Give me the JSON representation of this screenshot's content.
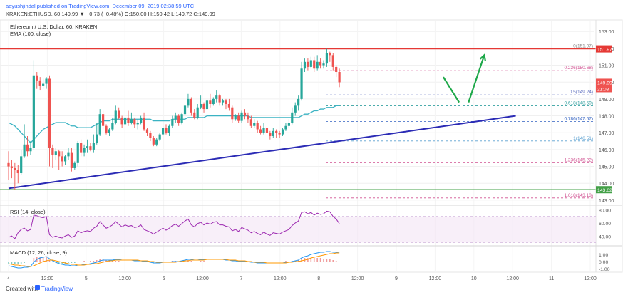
{
  "header": {
    "line1": "aayushjindal published on TradingView.com, December 09, 2019 02:38:59 UTC",
    "line2": "KRAKEN:ETHUSD, 60  149.99  ▼ −0.73 (−0.48%)  O:150.00  H:150.42  L:149.72  C:149.99"
  },
  "legend": {
    "title": "Ethereum / U.S. Dollar, 60, KRAKEN",
    "ema": "EMA (100, close)"
  },
  "footer": {
    "created_with": "Created with",
    "brand": "TradingView"
  },
  "colors": {
    "up": "#26a69a",
    "down": "#ef5350",
    "ema": "#3bb3c3",
    "trend": "#2b2bb5",
    "resistance": "#e53935",
    "support": "#43a047",
    "arrow": "#1ea84a",
    "rsi": "#9c27b0",
    "macd": "#2196f3",
    "signal": "#ff9800"
  },
  "chart_data": [
    {
      "type": "candlestick",
      "title": "Ethereum / U.S. Dollar, 60, KRAKEN",
      "ylim": [
        142.7,
        153.6
      ],
      "y_ticks": [
        "153.00",
        "152.00",
        "151.00",
        "150.00",
        "149.00",
        "148.00",
        "147.00",
        "146.00",
        "145.00",
        "144.00",
        "143.00"
      ],
      "x_ticks": [
        "4",
        "12:00",
        "5",
        "12:00",
        "6",
        "12:00",
        "7",
        "12:00",
        "8",
        "12:00",
        "9",
        "12:00",
        "10",
        "12:00",
        "11",
        "12:00"
      ],
      "price_labels": {
        "resistance": "151.97",
        "last": "149.99",
        "countdown": "21:08",
        "support": "143.62"
      },
      "horizontal_lines": {
        "resistance": 151.97,
        "support": 143.62
      },
      "fib_levels": [
        {
          "label": "0(151.97)",
          "value": 151.97
        },
        {
          "label": "0.236(150.68)",
          "value": 150.68
        },
        {
          "label": "0.5(149.24)",
          "value": 149.24
        },
        {
          "label": "0.618(148.59)",
          "value": 148.59
        },
        {
          "label": "0.786(147.67)",
          "value": 147.67
        },
        {
          "label": "1(146.51)",
          "value": 146.51
        },
        {
          "label": "1.236(145.22)",
          "value": 145.22
        },
        {
          "label": "1.618(143.13)",
          "value": 143.13
        }
      ],
      "candles": [
        [
          145.2,
          145.0,
          145.9,
          144.2
        ],
        [
          145.0,
          144.9,
          145.4,
          144.3
        ],
        [
          144.9,
          144.8,
          145.2,
          143.6
        ],
        [
          144.8,
          144.6,
          145.1,
          144.0
        ],
        [
          144.6,
          145.6,
          146.0,
          144.5
        ],
        [
          145.6,
          146.3,
          147.5,
          145.5
        ],
        [
          146.3,
          145.9,
          146.8,
          145.6
        ],
        [
          145.9,
          146.1,
          146.5,
          145.7
        ],
        [
          146.1,
          150.4,
          151.3,
          146.0
        ],
        [
          150.4,
          150.1,
          150.6,
          149.6
        ],
        [
          150.1,
          149.8,
          150.3,
          149.5
        ],
        [
          149.8,
          149.9,
          150.2,
          149.6
        ],
        [
          149.9,
          150.2,
          150.3,
          149.6
        ],
        [
          150.2,
          146.1,
          150.4,
          145.0
        ],
        [
          146.1,
          145.7,
          146.3,
          144.9
        ],
        [
          145.7,
          145.9,
          146.1,
          145.4
        ],
        [
          145.9,
          145.6,
          146.0,
          144.8
        ],
        [
          145.6,
          145.3,
          145.9,
          145.0
        ],
        [
          145.3,
          145.6,
          145.7,
          145.1
        ],
        [
          145.6,
          145.8,
          146.1,
          145.4
        ],
        [
          145.8,
          144.9,
          146.1,
          144.7
        ],
        [
          144.9,
          145.2,
          145.3,
          144.8
        ],
        [
          145.2,
          146.4,
          146.5,
          145.0
        ],
        [
          146.4,
          145.8,
          146.6,
          145.6
        ],
        [
          145.8,
          146.1,
          146.3,
          145.6
        ],
        [
          146.1,
          146.2,
          146.6,
          145.8
        ],
        [
          146.2,
          146.0,
          146.4,
          145.9
        ],
        [
          146.0,
          146.4,
          146.9,
          145.8
        ],
        [
          146.4,
          146.9,
          147.6,
          146.3
        ],
        [
          146.9,
          148.1,
          148.4,
          146.8
        ],
        [
          148.1,
          147.4,
          148.3,
          147.2
        ],
        [
          147.4,
          147.0,
          147.5,
          146.9
        ],
        [
          147.0,
          147.2,
          147.3,
          146.8
        ],
        [
          147.2,
          147.6,
          147.9,
          147.1
        ],
        [
          147.6,
          148.3,
          148.6,
          147.5
        ],
        [
          148.3,
          147.9,
          148.5,
          147.8
        ],
        [
          147.9,
          147.5,
          148.0,
          147.3
        ],
        [
          147.5,
          147.9,
          148.0,
          147.4
        ],
        [
          147.9,
          147.6,
          148.3,
          147.4
        ],
        [
          147.6,
          147.8,
          148.2,
          147.5
        ],
        [
          147.8,
          147.5,
          147.9,
          147.3
        ],
        [
          147.5,
          147.6,
          147.8,
          147.2
        ],
        [
          147.6,
          147.9,
          148.0,
          147.5
        ],
        [
          147.9,
          147.2,
          148.2,
          147.1
        ],
        [
          147.2,
          147.0,
          147.3,
          146.8
        ],
        [
          147.0,
          146.7,
          147.1,
          146.5
        ],
        [
          146.7,
          146.3,
          146.8,
          146.2
        ],
        [
          146.3,
          146.6,
          146.7,
          146.2
        ],
        [
          146.6,
          146.9,
          147.0,
          146.5
        ],
        [
          146.9,
          147.3,
          147.4,
          146.8
        ],
        [
          147.3,
          147.0,
          147.5,
          146.9
        ],
        [
          147.0,
          147.4,
          147.5,
          146.8
        ],
        [
          147.4,
          147.8,
          148.0,
          147.3
        ],
        [
          147.8,
          148.0,
          148.2,
          147.6
        ],
        [
          148.0,
          147.6,
          148.1,
          147.4
        ],
        [
          147.6,
          148.1,
          148.2,
          147.5
        ],
        [
          148.1,
          148.6,
          148.9,
          148.0
        ],
        [
          148.6,
          149.0,
          149.3,
          148.5
        ],
        [
          149.0,
          148.2,
          149.1,
          148.0
        ],
        [
          148.2,
          147.9,
          148.4,
          147.8
        ],
        [
          147.9,
          148.5,
          148.7,
          147.8
        ],
        [
          148.5,
          148.7,
          149.2,
          148.4
        ],
        [
          148.7,
          148.4,
          148.8,
          148.2
        ],
        [
          148.4,
          148.9,
          149.0,
          148.3
        ],
        [
          148.9,
          148.7,
          149.3,
          148.5
        ],
        [
          148.7,
          149.0,
          149.1,
          148.6
        ],
        [
          149.0,
          149.2,
          149.5,
          148.8
        ],
        [
          149.2,
          148.8,
          149.3,
          148.6
        ],
        [
          148.8,
          148.9,
          149.0,
          148.6
        ],
        [
          148.9,
          148.7,
          149.0,
          148.4
        ],
        [
          148.7,
          148.5,
          149.0,
          148.3
        ],
        [
          148.5,
          147.8,
          148.6,
          147.6
        ],
        [
          147.8,
          148.0,
          148.1,
          147.7
        ],
        [
          148.0,
          147.7,
          148.2,
          147.6
        ],
        [
          147.7,
          148.2,
          148.3,
          147.6
        ],
        [
          148.2,
          148.0,
          148.4,
          147.8
        ],
        [
          148.0,
          147.8,
          148.2,
          147.6
        ],
        [
          147.8,
          147.4,
          148.0,
          147.3
        ],
        [
          147.4,
          147.6,
          147.8,
          147.3
        ],
        [
          147.6,
          147.2,
          147.7,
          147.0
        ],
        [
          147.2,
          147.0,
          147.4,
          146.9
        ],
        [
          147.0,
          147.3,
          147.6,
          146.9
        ],
        [
          147.3,
          147.0,
          147.4,
          146.9
        ],
        [
          147.0,
          146.8,
          147.1,
          146.6
        ],
        [
          146.8,
          147.1,
          147.3,
          146.7
        ],
        [
          147.1,
          147.0,
          147.2,
          146.7
        ],
        [
          147.0,
          146.9,
          147.1,
          146.7
        ],
        [
          146.9,
          147.2,
          147.3,
          146.8
        ],
        [
          147.2,
          147.4,
          147.6,
          147.1
        ],
        [
          147.4,
          147.6,
          147.8,
          147.3
        ],
        [
          147.6,
          148.2,
          148.5,
          147.5
        ],
        [
          148.2,
          148.6,
          148.8,
          148.0
        ],
        [
          148.6,
          149.0,
          149.2,
          148.3
        ],
        [
          149.0,
          150.8,
          151.2,
          148.9
        ],
        [
          150.8,
          151.2,
          151.4,
          150.6
        ],
        [
          151.2,
          150.9,
          151.4,
          150.7
        ],
        [
          150.9,
          151.3,
          151.5,
          150.8
        ],
        [
          151.3,
          150.8,
          151.5,
          150.6
        ],
        [
          150.8,
          151.2,
          151.6,
          150.7
        ],
        [
          151.2,
          151.0,
          151.4,
          150.8
        ],
        [
          151.0,
          151.1,
          151.3,
          150.8
        ],
        [
          151.1,
          151.7,
          151.97,
          150.9
        ],
        [
          151.7,
          151.6,
          151.8,
          151.2
        ],
        [
          151.6,
          150.9,
          151.7,
          150.7
        ],
        [
          150.9,
          150.6,
          151.0,
          150.3
        ],
        [
          150.6,
          149.99,
          150.8,
          149.7
        ]
      ],
      "ema": [
        147.6,
        147.5,
        147.4,
        147.2,
        147.0,
        146.8,
        146.6,
        146.4,
        146.6,
        146.8,
        147.0,
        147.2,
        147.3,
        147.4,
        147.5,
        147.6,
        147.6,
        147.6,
        147.6,
        147.5,
        147.4,
        147.4,
        147.3,
        147.3,
        147.3,
        147.3,
        147.3,
        147.4,
        147.5,
        147.6,
        147.7,
        147.7,
        147.7,
        147.8,
        147.8,
        147.8,
        147.8,
        147.8,
        147.8,
        147.8,
        147.8,
        147.8,
        147.8,
        147.8,
        147.8,
        147.8,
        147.7,
        147.7,
        147.7,
        147.7,
        147.7,
        147.7,
        147.8,
        147.8,
        147.8,
        147.8,
        147.8,
        147.9,
        147.9,
        147.9,
        147.9,
        147.9,
        147.9,
        148.0,
        148.0,
        148.0,
        148.0,
        148.0,
        148.0,
        148.0,
        148.0,
        148.0,
        148.0,
        148.0,
        148.0,
        148.0,
        148.0,
        147.9,
        147.9,
        147.9,
        147.9,
        147.9,
        147.9,
        147.9,
        147.9,
        147.9,
        147.9,
        147.9,
        147.9,
        147.9,
        147.9,
        147.9,
        147.9,
        148.0,
        148.1,
        148.1,
        148.2,
        148.3,
        148.3,
        148.4,
        148.4,
        148.5,
        148.5,
        148.5,
        148.6,
        148.6
      ],
      "trendline": {
        "from": {
          "bar": 0,
          "value": 143.7
        },
        "to": {
          "bar": 161,
          "value": 148.0
        }
      },
      "arrows": [
        {
          "from_bar": 138,
          "from_value": 150.3,
          "to_bar": 143,
          "to_value": 148.8
        },
        {
          "from_bar": 146,
          "from_value": 148.8,
          "to_bar": 151,
          "to_value": 151.6
        }
      ]
    },
    {
      "type": "line",
      "title": "RSI (14, close)",
      "ylim": [
        25,
        85
      ],
      "y_ticks": [
        "80.00",
        "60.00",
        "40.00"
      ],
      "band": [
        30,
        70
      ],
      "series": [
        {
          "name": "RSI",
          "values": [
            38,
            40,
            36,
            45,
            50,
            52,
            48,
            50,
            72,
            71,
            69,
            68,
            70,
            42,
            38,
            40,
            38,
            37,
            40,
            42,
            38,
            40,
            48,
            45,
            47,
            48,
            47,
            52,
            55,
            62,
            57,
            52,
            54,
            57,
            62,
            58,
            54,
            57,
            55,
            56,
            53,
            54,
            57,
            50,
            48,
            46,
            43,
            46,
            49,
            52,
            49,
            52,
            56,
            58,
            55,
            59,
            63,
            66,
            57,
            54,
            59,
            61,
            57,
            60,
            58,
            61,
            62,
            57,
            57,
            55,
            54,
            48,
            50,
            47,
            53,
            51,
            49,
            45,
            47,
            44,
            42,
            46,
            43,
            41,
            45,
            44,
            43,
            46,
            48,
            50,
            56,
            60,
            63,
            76,
            77,
            74,
            76,
            72,
            75,
            73,
            74,
            78,
            77,
            70,
            66,
            59
          ]
        }
      ]
    },
    {
      "type": "line",
      "title": "MACD (12, 26, close, 9)",
      "ylim": [
        -1.5,
        2.0
      ],
      "y_ticks": [
        "1.00",
        "0.00",
        "-1.00"
      ],
      "series": [
        {
          "name": "MACD",
          "values": [
            -0.6,
            -0.7,
            -0.8,
            -0.9,
            -0.9,
            -0.8,
            -0.8,
            -0.7,
            -0.1,
            0.3,
            0.5,
            0.6,
            0.7,
            0.4,
            0.1,
            -0.1,
            -0.3,
            -0.4,
            -0.5,
            -0.5,
            -0.6,
            -0.6,
            -0.5,
            -0.5,
            -0.4,
            -0.4,
            -0.3,
            -0.2,
            -0.1,
            0.1,
            0.2,
            0.2,
            0.2,
            0.2,
            0.3,
            0.3,
            0.2,
            0.2,
            0.2,
            0.2,
            0.1,
            0.1,
            0.1,
            0.0,
            0.0,
            -0.1,
            -0.2,
            -0.2,
            -0.2,
            -0.1,
            -0.1,
            -0.1,
            0.0,
            0.0,
            0.0,
            0.1,
            0.2,
            0.3,
            0.3,
            0.2,
            0.2,
            0.3,
            0.3,
            0.3,
            0.3,
            0.3,
            0.3,
            0.3,
            0.3,
            0.2,
            0.2,
            0.1,
            0.1,
            0.0,
            0.0,
            0.0,
            0.0,
            -0.1,
            -0.1,
            -0.2,
            -0.2,
            -0.2,
            -0.2,
            -0.2,
            -0.2,
            -0.2,
            -0.2,
            -0.2,
            -0.1,
            -0.1,
            0.0,
            0.1,
            0.2,
            0.5,
            0.7,
            0.8,
            1.0,
            1.1,
            1.2,
            1.3,
            1.3,
            1.4,
            1.4,
            1.3,
            1.3,
            1.2
          ]
        },
        {
          "name": "Signal",
          "values": [
            -0.3,
            -0.4,
            -0.5,
            -0.5,
            -0.6,
            -0.6,
            -0.7,
            -0.7,
            -0.6,
            -0.4,
            -0.2,
            0.0,
            0.1,
            0.2,
            0.2,
            0.1,
            0.0,
            -0.1,
            -0.2,
            -0.3,
            -0.4,
            -0.4,
            -0.5,
            -0.5,
            -0.5,
            -0.4,
            -0.4,
            -0.3,
            -0.3,
            -0.2,
            -0.1,
            0.0,
            0.1,
            0.1,
            0.2,
            0.2,
            0.2,
            0.2,
            0.2,
            0.2,
            0.2,
            0.2,
            0.1,
            0.1,
            0.1,
            0.0,
            0.0,
            -0.1,
            -0.1,
            -0.1,
            -0.1,
            -0.1,
            -0.1,
            -0.1,
            0.0,
            0.0,
            0.1,
            0.1,
            0.2,
            0.2,
            0.2,
            0.2,
            0.2,
            0.3,
            0.3,
            0.3,
            0.3,
            0.3,
            0.3,
            0.3,
            0.2,
            0.2,
            0.2,
            0.1,
            0.1,
            0.1,
            0.0,
            0.0,
            -0.1,
            -0.1,
            -0.1,
            -0.1,
            -0.2,
            -0.2,
            -0.2,
            -0.2,
            -0.2,
            -0.2,
            -0.2,
            -0.1,
            -0.1,
            0.0,
            0.0,
            0.1,
            0.2,
            0.3,
            0.5,
            0.6,
            0.7,
            0.8,
            0.9,
            1.0,
            1.1,
            1.1,
            1.2,
            1.2
          ]
        }
      ]
    }
  ]
}
